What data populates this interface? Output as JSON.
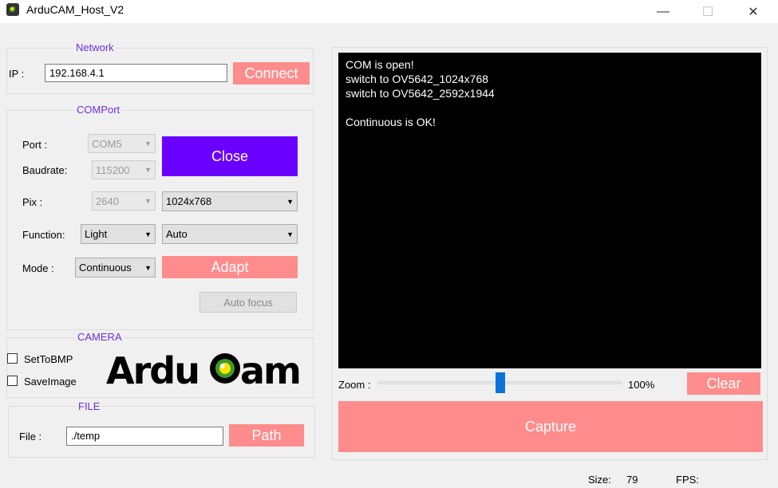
{
  "window": {
    "title": "ArduCAM_Host_V2",
    "minimize": "—",
    "maximize": "☐",
    "close": "✕"
  },
  "network": {
    "group_title": "Network",
    "ip_label": "IP :",
    "ip_value": "192.168.4.1",
    "connect_label": "Connect"
  },
  "comport": {
    "group_title": "COMPort",
    "port_label": "Port   :",
    "port_value": "COM5",
    "baud_label": "Baudrate:",
    "baud_value": "115200",
    "close_label": "Close",
    "pix_label": "Pix    :",
    "pix_value": "2640",
    "resolution_value": "1024x768",
    "function_label": "Function:",
    "function_value": "Light",
    "function_mode_value": "Auto",
    "mode_label": "Mode   :",
    "mode_value": "Continuous",
    "adapt_label": "Adapt",
    "autofocus_label": "Auto focus"
  },
  "camera": {
    "group_title": "CAMERA",
    "settobmp_label": "SetToBMP",
    "saveimage_label": "SaveImage",
    "logo_text": "ArduCam"
  },
  "file": {
    "group_title": "FILE",
    "file_label": "File :",
    "file_value": "./temp",
    "path_label": "Path"
  },
  "console": {
    "text": "COM is open!\nswitch to OV5642_1024x768\nswitch to OV5642_2592x1944\n\nContinuous is OK!"
  },
  "zoom": {
    "label": "Zoom :",
    "value": "100%",
    "slider_fraction": 0.5,
    "clear_label": "Clear"
  },
  "capture_label": "Capture",
  "status": {
    "size_label": "Size:",
    "size_value": "79",
    "fps_label": "FPS:"
  },
  "colors": {
    "accent_purple": "#6a00ff",
    "pink": "#ff8c8c",
    "group_title": "#6f2de0",
    "slider_thumb": "#0a74da"
  }
}
